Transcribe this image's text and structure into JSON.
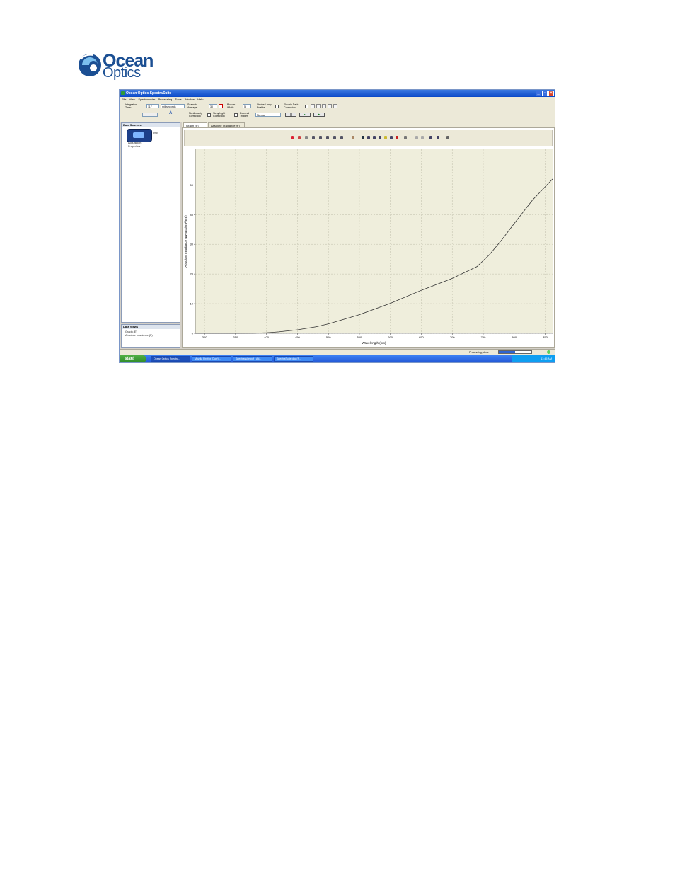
{
  "header": {
    "logo_word1": "Ocean",
    "logo_word2": "Optics"
  },
  "app": {
    "title": "Ocean Optics SpectraSuite",
    "menu": [
      "File",
      "View",
      "Spectrometer",
      "Processing",
      "Tools",
      "Window",
      "Help"
    ],
    "toolbar": {
      "integration_label": "Integration Time:",
      "integration_value": "117",
      "integration_unit": "milliseconds",
      "scans_label": "Scans to Average:",
      "scans_value": "30",
      "boxcar_label": "Boxcar Width:",
      "boxcar_value": "5",
      "strobe_label": "Strobe/Lamp Enable",
      "dark_label": "Electric Dark Correction",
      "nonlinearity_label": "Nonlinearity Correction",
      "straylight_label": "Stray Light Correction",
      "trigger_label": "External Trigger",
      "trigger_value": "Normal"
    },
    "left_panel": {
      "data_sources_title": "Data Sources",
      "device_label": "USB",
      "items": [
        "Acquisition",
        "Properties"
      ],
      "data_views_title": "Data Views",
      "views": [
        "Graph (E)",
        "Absolute Irradiance (F)"
      ]
    },
    "tabs": [
      "Graph (E)",
      "Absolute Irradiance (F)"
    ],
    "status": {
      "text": "Processing, done",
      "progress": 0.5
    },
    "taskbar": {
      "start": "start",
      "tasks": [
        "Ocean Optics Spectra...",
        "Mozilla Firefox (Don't...",
        "Spectrasuite.pdf - Ad...",
        "SpectraSuite.doc (R..."
      ],
      "clock": "11:45 AM"
    }
  },
  "chart_data": {
    "type": "line",
    "xlabel": "Wavelength (nm)",
    "ylabel": "Absolute Irradiance (µWatts/cm²/nm)",
    "xlim": [
      285,
      862
    ],
    "ylim": [
      0,
      62
    ],
    "xticks": [
      "300",
      "350",
      "400",
      "450",
      "500",
      "550",
      "600",
      "650",
      "700",
      "750",
      "800",
      "850"
    ],
    "xtick_values": [
      300,
      350,
      400,
      450,
      500,
      550,
      600,
      650,
      700,
      750,
      800,
      850
    ],
    "yticks": [
      "0",
      "10",
      "20",
      "30",
      "40",
      "50"
    ],
    "ytick_values": [
      0,
      10,
      20,
      30,
      40,
      50
    ],
    "grid": true,
    "series": [
      {
        "x": [
          285,
          350,
          380,
          400,
          420,
          450,
          480,
          500,
          550,
          600,
          650,
          700,
          740,
          760,
          780,
          800,
          830,
          862
        ],
        "y": [
          0,
          0,
          0.05,
          0.2,
          0.5,
          1.2,
          2.2,
          3.2,
          6.3,
          10.1,
          14.5,
          18.5,
          22.5,
          26.5,
          31.5,
          37,
          45,
          52
        ]
      }
    ]
  }
}
